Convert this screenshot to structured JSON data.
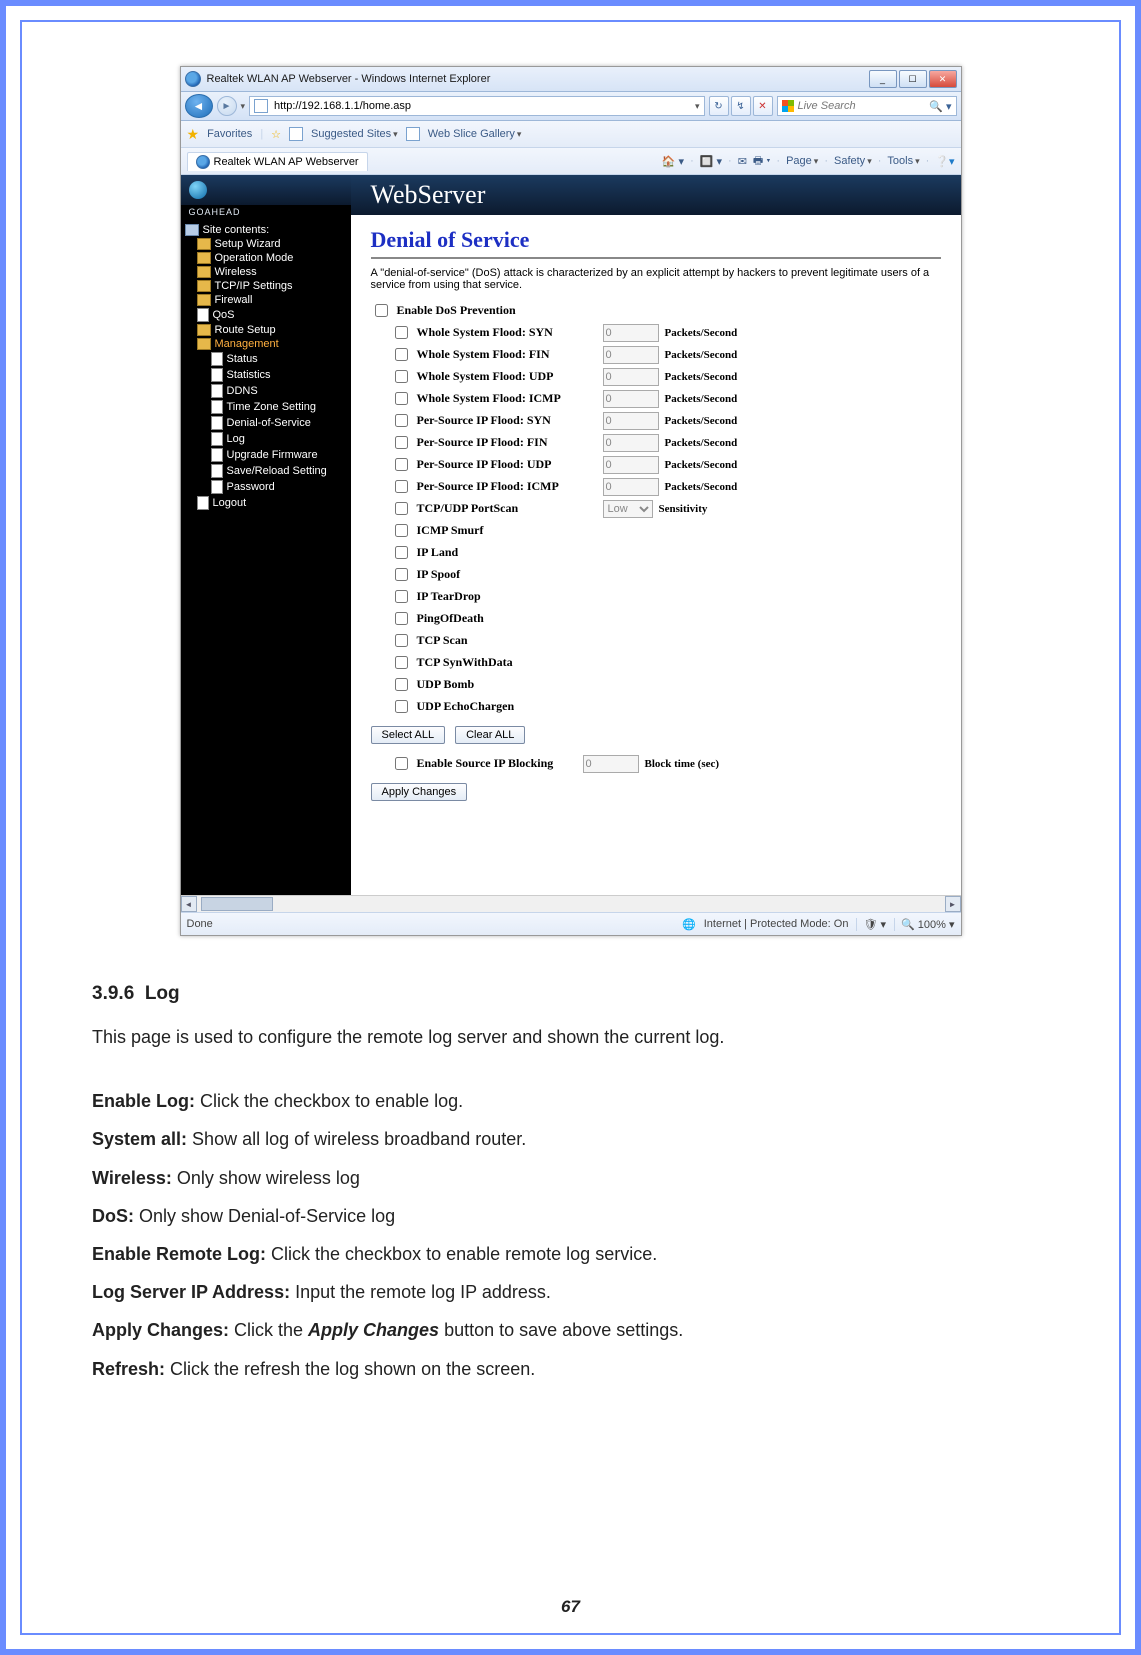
{
  "window": {
    "title": "Realtek WLAN AP Webserver - Windows Internet Explorer",
    "min_tip": "_",
    "max_tip": "☐",
    "close_tip": "✕"
  },
  "address": {
    "url": "http://192.168.1.1/home.asp",
    "search_placeholder": "Live Search",
    "mag_icon": "🔍"
  },
  "favbar": {
    "favorites": "Favorites",
    "suggested": "Suggested Sites",
    "webslice": "Web Slice Gallery"
  },
  "tab": {
    "label": "Realtek WLAN AP Webserver"
  },
  "tools": {
    "page": "Page",
    "safety": "Safety",
    "tools": "Tools"
  },
  "sidebar": {
    "title": "Site contents:",
    "brand": "GOAHEAD",
    "items": [
      {
        "label": "Setup Wizard",
        "lvl": 1,
        "icon": "folder"
      },
      {
        "label": "Operation Mode",
        "lvl": 1,
        "icon": "folder"
      },
      {
        "label": "Wireless",
        "lvl": 1,
        "icon": "folder"
      },
      {
        "label": "TCP/IP Settings",
        "lvl": 1,
        "icon": "folder"
      },
      {
        "label": "Firewall",
        "lvl": 1,
        "icon": "folder"
      },
      {
        "label": "QoS",
        "lvl": 1,
        "icon": "doc"
      },
      {
        "label": "Route Setup",
        "lvl": 1,
        "icon": "folder"
      },
      {
        "label": "Management",
        "lvl": 1,
        "icon": "folder",
        "selected": true
      },
      {
        "label": "Status",
        "lvl": 2,
        "icon": "doc"
      },
      {
        "label": "Statistics",
        "lvl": 2,
        "icon": "doc"
      },
      {
        "label": "DDNS",
        "lvl": 2,
        "icon": "doc"
      },
      {
        "label": "Time Zone Setting",
        "lvl": 2,
        "icon": "doc"
      },
      {
        "label": "Denial-of-Service",
        "lvl": 2,
        "icon": "doc"
      },
      {
        "label": "Log",
        "lvl": 2,
        "icon": "doc"
      },
      {
        "label": "Upgrade Firmware",
        "lvl": 2,
        "icon": "doc"
      },
      {
        "label": "Save/Reload Setting",
        "lvl": 2,
        "icon": "doc"
      },
      {
        "label": "Password",
        "lvl": 2,
        "icon": "doc"
      },
      {
        "label": "Logout",
        "lvl": 1,
        "icon": "doc"
      }
    ]
  },
  "banner": {
    "title": "WebServer"
  },
  "main": {
    "title": "Denial of Service",
    "desc": "A \"denial-of-service\" (DoS) attack is characterized by an explicit attempt by hackers to prevent legitimate users of a service from using that service.",
    "enable_prevention": "Enable DoS Prevention",
    "rows": [
      {
        "label": "Whole System Flood: SYN",
        "value": "0",
        "unit": "Packets/Second"
      },
      {
        "label": "Whole System Flood: FIN",
        "value": "0",
        "unit": "Packets/Second"
      },
      {
        "label": "Whole System Flood: UDP",
        "value": "0",
        "unit": "Packets/Second"
      },
      {
        "label": "Whole System Flood: ICMP",
        "value": "0",
        "unit": "Packets/Second"
      },
      {
        "label": "Per-Source IP Flood: SYN",
        "value": "0",
        "unit": "Packets/Second"
      },
      {
        "label": "Per-Source IP Flood: FIN",
        "value": "0",
        "unit": "Packets/Second"
      },
      {
        "label": "Per-Source IP Flood: UDP",
        "value": "0",
        "unit": "Packets/Second"
      },
      {
        "label": "Per-Source IP Flood: ICMP",
        "value": "0",
        "unit": "Packets/Second"
      }
    ],
    "portscan": {
      "label": "TCP/UDP PortScan",
      "value": "Low",
      "unit": "Sensitivity"
    },
    "flags": [
      "ICMP Smurf",
      "IP Land",
      "IP Spoof",
      "IP TearDrop",
      "PingOfDeath",
      "TCP Scan",
      "TCP SynWithData",
      "UDP Bomb",
      "UDP EchoChargen"
    ],
    "select_all": "Select ALL",
    "clear_all": "Clear ALL",
    "source_ip_blocking": "Enable Source IP Blocking",
    "block_time_value": "0",
    "block_time_unit": "Block time (sec)",
    "apply": "Apply Changes"
  },
  "status": {
    "done": "Done",
    "zone": "Internet | Protected Mode: On",
    "zoom": "100%"
  },
  "doc": {
    "heading_num": "3.9.6",
    "heading": "Log",
    "intro": "This page is used to configure the remote log server and shown the current log.",
    "defs": [
      {
        "term": "Enable Log:",
        "text": " Click the checkbox to enable log."
      },
      {
        "term": "System all:",
        "text": " Show all log of wireless broadband router."
      },
      {
        "term": "Wireless:",
        "text": " Only show wireless log"
      },
      {
        "term": "DoS:",
        "text": " Only show Denial-of-Service log"
      },
      {
        "term": "Enable Remote Log:",
        "text": " Click the checkbox to enable remote log service."
      },
      {
        "term": "Log Server IP Address:",
        "text": " Input the remote log IP address."
      },
      {
        "term": "Apply Changes:",
        "text": " Click the ",
        "em": "Apply Changes",
        "text2": " button to save above settings."
      },
      {
        "term": "Refresh:",
        "text": " Click the refresh the log shown on the screen."
      }
    ],
    "page_number": "67"
  }
}
